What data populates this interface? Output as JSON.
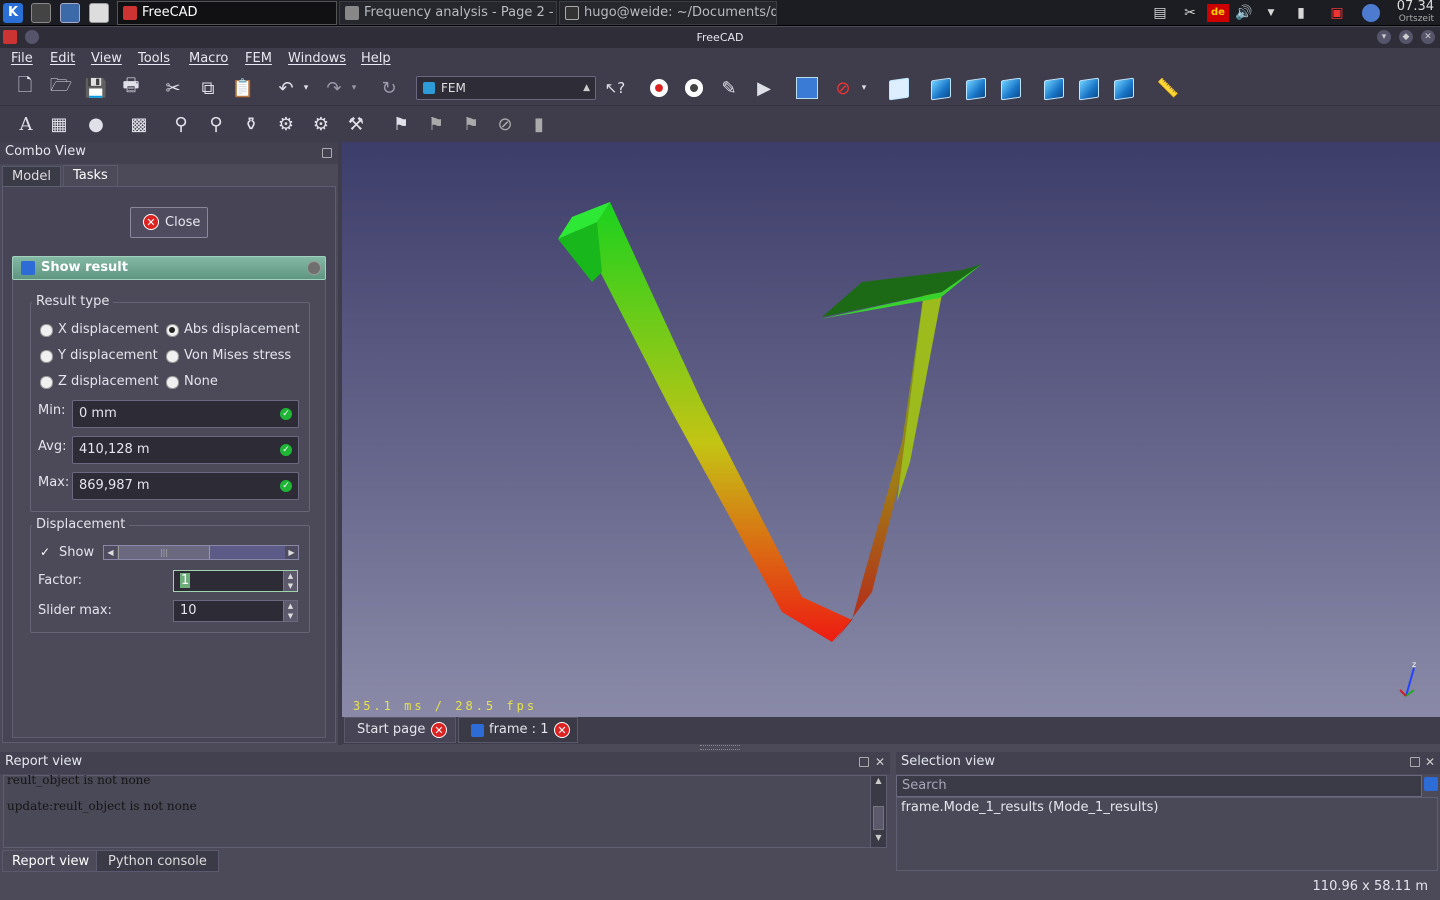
{
  "taskbar": {
    "tasks": [
      {
        "label": "FreeCAD"
      },
      {
        "label": "Frequency analysis - Page 2 - "
      },
      {
        "label": "hugo@weide: ~/Documents/d"
      }
    ],
    "keyboard_layout": "de",
    "clock_time": "07.34",
    "clock_label": "Ortszeit"
  },
  "window": {
    "title": "FreeCAD"
  },
  "menubar": [
    "File",
    "Edit",
    "View",
    "Tools",
    "Macro",
    "FEM",
    "Windows",
    "Help"
  ],
  "toolbar": {
    "workbench": "FEM"
  },
  "combo_view": {
    "title": "Combo View",
    "tabs": [
      "Model",
      "Tasks"
    ],
    "close_label": "Close",
    "show_result": {
      "title": "Show result",
      "result_type_label": "Result type",
      "options": {
        "x_disp": "X displacement",
        "abs_disp": "Abs displacement",
        "y_disp": "Y displacement",
        "von_mises": "Von Mises stress",
        "z_disp": "Z displacement",
        "none": "None"
      },
      "selected_option": "Abs displacement",
      "min_label": "Min:",
      "min_value": "0 mm",
      "avg_label": "Avg:",
      "avg_value": "410,128 m",
      "max_label": "Max:",
      "max_value": "869,987 m",
      "displacement_label": "Displacement",
      "show_label": "Show",
      "show_checked": true,
      "factor_label": "Factor:",
      "factor_value": "1",
      "slider_max_label": "Slider max:",
      "slider_max_value": "10"
    }
  },
  "viewport": {
    "fps_text": "35.1 ms / 28.5 fps"
  },
  "doc_tabs": [
    "Start page",
    "frame : 1"
  ],
  "report_view": {
    "title": "Report view",
    "lines": [
      "reult_object is not none",
      "update:reult_object is not none"
    ],
    "bottom_tabs": [
      "Report view",
      "Python console"
    ]
  },
  "selection_view": {
    "title": "Selection view",
    "search_placeholder": "Search",
    "items": [
      "frame.Mode_1_results (Mode_1_results)"
    ]
  },
  "status": {
    "dimensions": "110.96 x 58.11 m"
  },
  "colors": {
    "accent": "#6f9e8c",
    "viewport_top": "#3d3d6a",
    "viewport_bottom": "#8a8aa8",
    "fps_text": "#e6e24a"
  }
}
